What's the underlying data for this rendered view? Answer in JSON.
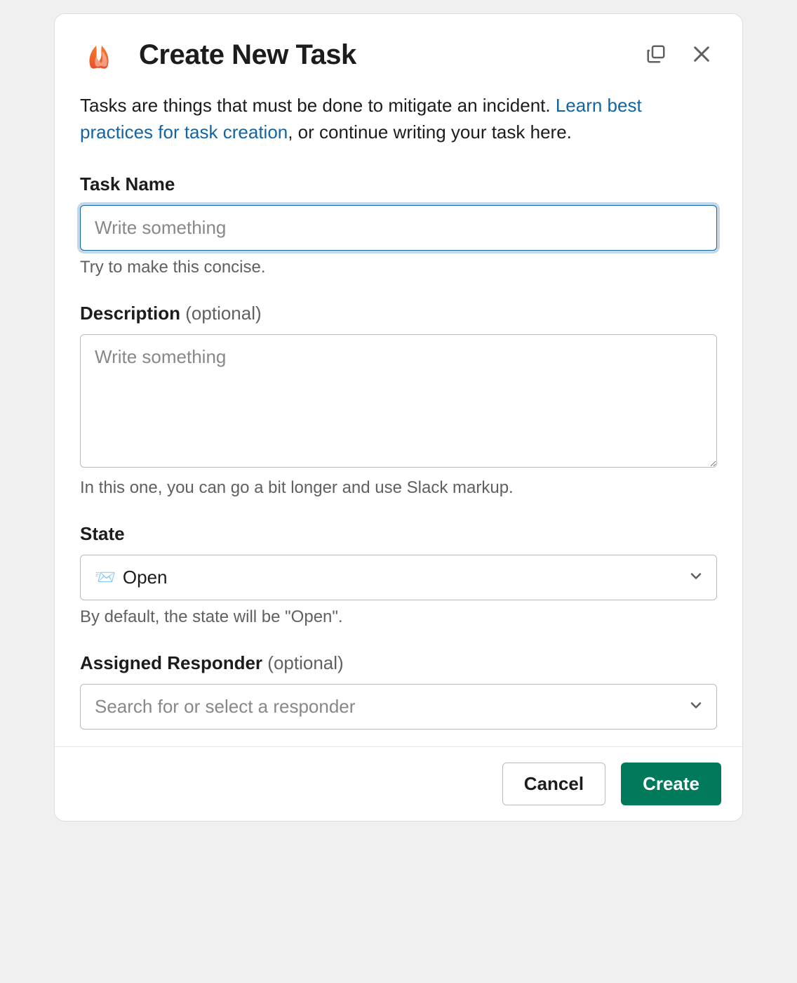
{
  "header": {
    "title": "Create New Task"
  },
  "intro": {
    "text_before": "Tasks are things that must be done to mitigate an incident. ",
    "link_text": "Learn best practices for task creation",
    "text_after": ", or continue writing your task here."
  },
  "fields": {
    "task_name": {
      "label": "Task Name",
      "placeholder": "Write something",
      "hint": "Try to make this concise."
    },
    "description": {
      "label": "Description",
      "optional": "(optional)",
      "placeholder": "Write something",
      "hint": "In this one, you can go a bit longer and use Slack markup."
    },
    "state": {
      "label": "State",
      "value": "Open",
      "hint": "By default, the state will be \"Open\"."
    },
    "responder": {
      "label": "Assigned Responder",
      "optional": "(optional)",
      "placeholder": "Search for or select a responder"
    }
  },
  "footer": {
    "cancel": "Cancel",
    "create": "Create"
  }
}
